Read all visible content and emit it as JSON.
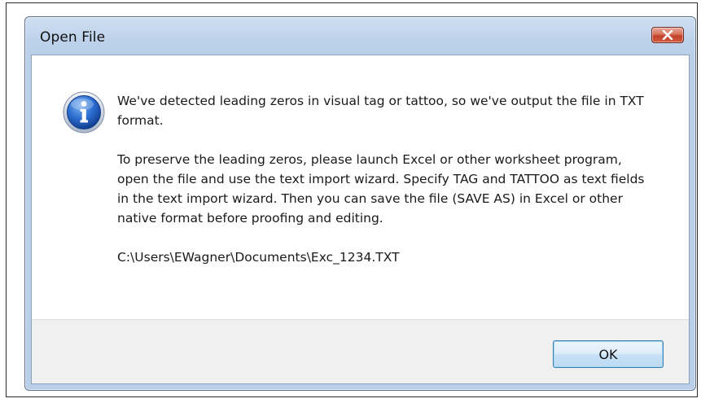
{
  "dialog": {
    "title": "Open File",
    "icon": "info-icon",
    "message": {
      "paragraph1": "We've detected leading zeros in visual tag or tattoo, so we've output the file in TXT format.",
      "paragraph2": "To preserve the leading zeros, please launch Excel or other worksheet program, open the file and use the text import wizard. Specify TAG and TATTOO as text fields in the text import wizard. Then you can save the file (SAVE AS) in Excel or other native format before proofing and editing.",
      "file_path": "C:\\Users\\EWagner\\Documents\\Exc_1234.TXT"
    },
    "ok_label": "OK",
    "colors": {
      "titlebar": "#bcd1ea",
      "close_button": "#c2412a",
      "ok_border": "#3c7fb1",
      "icon_blue": "#1f5fbf"
    }
  }
}
